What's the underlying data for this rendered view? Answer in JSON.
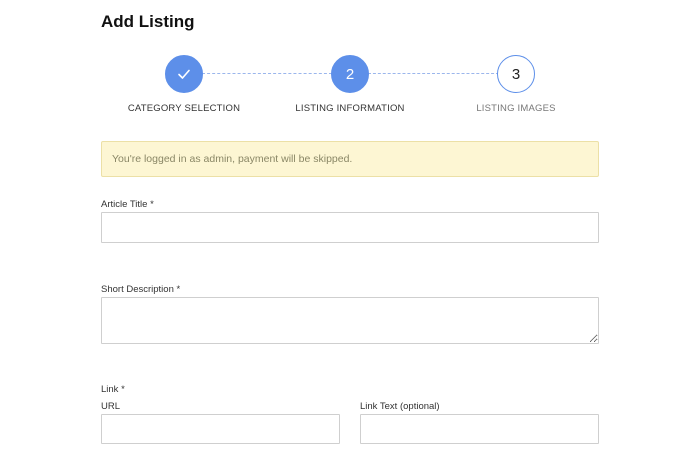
{
  "page": {
    "title": "Add Listing"
  },
  "stepper": {
    "steps": [
      {
        "label": "CATEGORY SELECTION",
        "marker": "",
        "state": "completed",
        "icon": "check-icon"
      },
      {
        "label": "LISTING INFORMATION",
        "marker": "2",
        "state": "active"
      },
      {
        "label": "LISTING IMAGES",
        "marker": "3",
        "state": "upcoming"
      }
    ],
    "accent_color": "#5d8fe9"
  },
  "notice": {
    "text": "You're logged in as admin, payment will be skipped.",
    "background_color": "#fdf6d3"
  },
  "form": {
    "article_title": {
      "label": "Article Title *",
      "value": ""
    },
    "short_description": {
      "label": "Short Description *",
      "value": ""
    },
    "link": {
      "label": "Link *",
      "url": {
        "label": "URL",
        "value": ""
      },
      "link_text": {
        "label": "Link Text (optional)",
        "value": ""
      }
    }
  }
}
